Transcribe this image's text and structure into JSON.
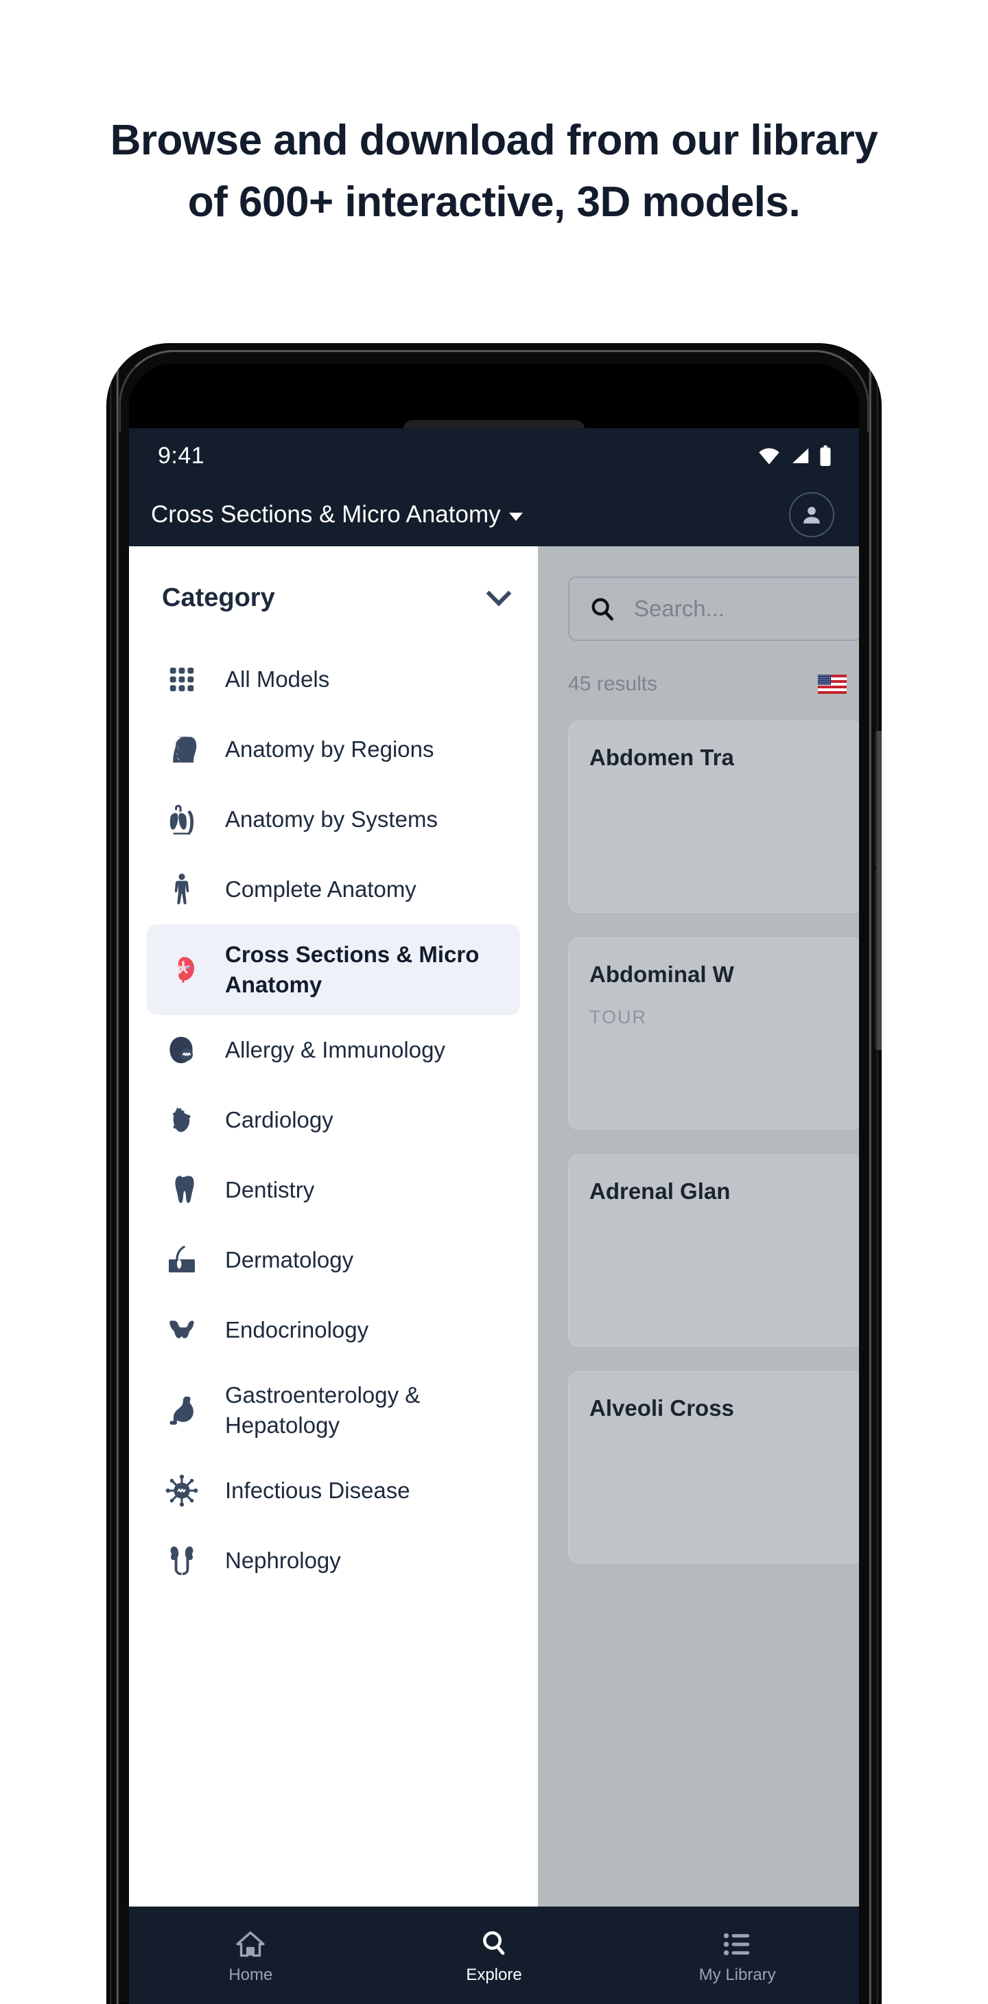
{
  "hero": {
    "line1": "Browse and download from our library",
    "line2": "of 600+ interactive, 3D models."
  },
  "colors": {
    "app_dark": "#141d2b",
    "accent_icon": "#3b4a63",
    "selected_bg": "#eef1f8",
    "kidney_red": "#ef4a5b",
    "pane_grey": "#b5babe",
    "card_grey": "#bfc4c8"
  },
  "statusbar": {
    "time": "9:41",
    "icons": [
      "wifi-icon",
      "cellular-signal-icon",
      "battery-icon"
    ]
  },
  "appbar": {
    "title": "Cross Sections & Micro Anatomy",
    "dropdown_icon": "caret-down-icon",
    "account_icon": "account-avatar-icon"
  },
  "sidebar": {
    "header": "Category",
    "header_icon": "chevron-down-icon",
    "items": [
      {
        "label": "All Models",
        "icon": "grid-icon",
        "selected": false
      },
      {
        "label": "Anatomy by Regions",
        "icon": "head-profile-icon",
        "selected": false
      },
      {
        "label": "Anatomy by Systems",
        "icon": "torso-lungs-icon",
        "selected": false
      },
      {
        "label": "Complete Anatomy",
        "icon": "full-body-icon",
        "selected": false
      },
      {
        "label": "Cross Sections & Micro Anatomy",
        "icon": "kidney-cross-section-icon",
        "selected": true
      },
      {
        "label": "Allergy & Immunology",
        "icon": "allergy-cell-icon",
        "selected": false
      },
      {
        "label": "Cardiology",
        "icon": "heart-icon",
        "selected": false
      },
      {
        "label": "Dentistry",
        "icon": "tooth-icon",
        "selected": false
      },
      {
        "label": "Dermatology",
        "icon": "skin-follicle-icon",
        "selected": false
      },
      {
        "label": "Endocrinology",
        "icon": "thyroid-icon",
        "selected": false
      },
      {
        "label": "Gastroenterology & Hepatology",
        "icon": "stomach-icon",
        "selected": false
      },
      {
        "label": "Infectious Disease",
        "icon": "virus-icon",
        "selected": false
      },
      {
        "label": "Nephrology",
        "icon": "kidneys-icon",
        "selected": false
      }
    ]
  },
  "results": {
    "search_placeholder": "Search...",
    "search_value": "",
    "search_icon": "search-icon",
    "count_label": "45 results",
    "locale_icon": "us-flag-icon",
    "cards": [
      {
        "title": "Abdomen Tra",
        "tag": ""
      },
      {
        "title": "Abdominal W",
        "tag": "TOUR"
      },
      {
        "title": "Adrenal Glan",
        "tag": ""
      },
      {
        "title": "Alveoli Cross",
        "tag": ""
      }
    ]
  },
  "bottomnav": {
    "items": [
      {
        "label": "Home",
        "icon": "home-icon",
        "active": false
      },
      {
        "label": "Explore",
        "icon": "search-icon",
        "active": true
      },
      {
        "label": "My Library",
        "icon": "list-icon",
        "active": false
      }
    ]
  }
}
